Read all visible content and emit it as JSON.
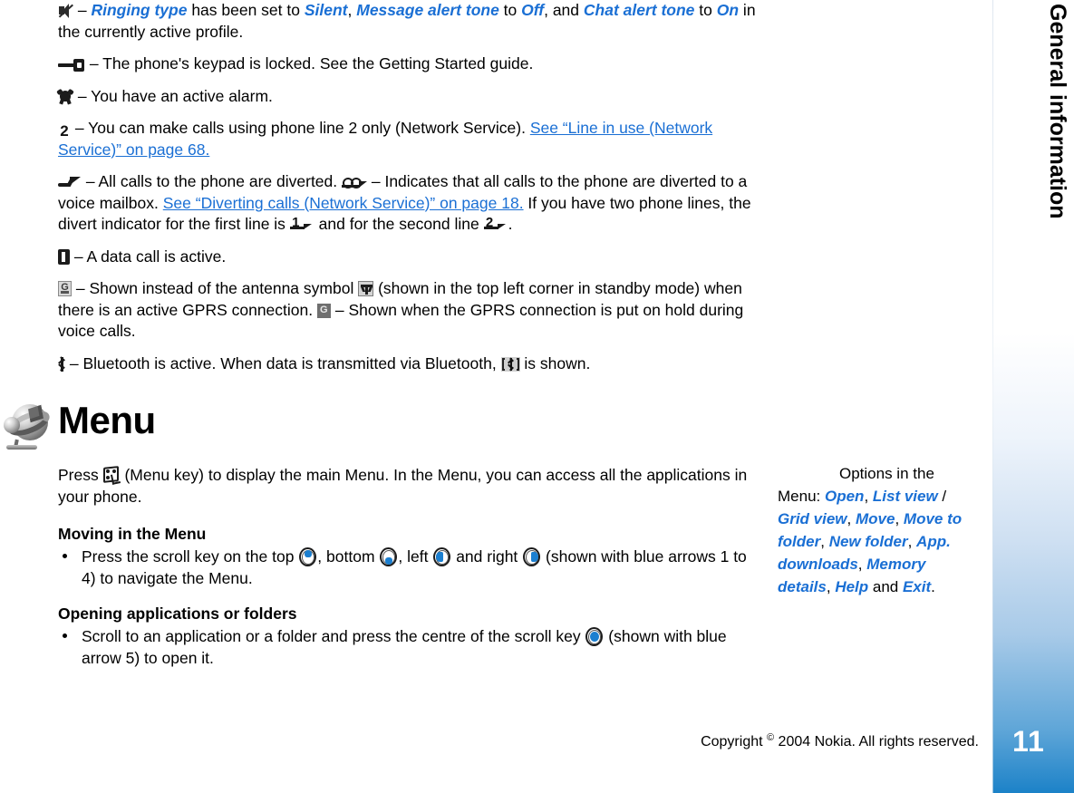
{
  "chapter": {
    "label": "General information"
  },
  "page": {
    "number": "11"
  },
  "colors": {
    "link": "#1a6fd4",
    "accent_blue": "#1b7fd0",
    "page_tab": "#1c82c8"
  },
  "status_icons": [
    {
      "icon": "silent-profile-icon",
      "text_parts": [
        {
          "t": " – ",
          "style": "plain"
        },
        {
          "t": "Ringing type",
          "style": "blue-italic"
        },
        {
          "t": " has been set to ",
          "style": "plain"
        },
        {
          "t": "Silent",
          "style": "blue-italic"
        },
        {
          "t": ", ",
          "style": "plain"
        },
        {
          "t": "Message alert tone",
          "style": "blue-italic"
        },
        {
          "t": " to ",
          "style": "plain"
        },
        {
          "t": "Off",
          "style": "blue-italic"
        },
        {
          "t": ", and ",
          "style": "plain"
        },
        {
          "t": "Chat alert tone",
          "style": "blue-italic"
        },
        {
          "t": " to ",
          "style": "plain"
        },
        {
          "t": "On",
          "style": "blue-italic"
        },
        {
          "t": " in the currently active profile.",
          "style": "plain"
        }
      ]
    },
    {
      "icon": "keypad-lock-icon",
      "text": " – The phone's keypad is locked. See the Getting Started guide."
    },
    {
      "icon": "alarm-icon",
      "text": " – You have an active alarm."
    },
    {
      "icon": "phone-line-2-icon",
      "text_before": " – You can make calls using phone line 2 only (Network Service). ",
      "link": "See “Line in use (Network Service)” on page 68."
    }
  ],
  "divert_paragraph": {
    "icon_divert": "call-divert-icon",
    "text1": " – All calls to the phone are diverted. ",
    "icon_mailbox": "divert-to-voice-mailbox-icon",
    "text2": " – Indicates that all calls to the phone are diverted to a voice mailbox. ",
    "link": "See “Diverting calls (Network Service)” on page 18.",
    "text3": " If you have two phone lines, the divert indicator for the first line is ",
    "icon_line1": "divert-line-1-icon",
    "line1_digit": "1",
    "text4": " and for the second line ",
    "icon_line2": "divert-line-2-icon",
    "line2_digit": "2",
    "text5": "."
  },
  "data_call": {
    "icon": "data-call-icon",
    "text": " – A data call is active."
  },
  "gprs_paragraph": {
    "icon_gprs": "gprs-active-icon",
    "gprs_letter": "G",
    "text1": " – Shown instead of the antenna symbol ",
    "icon_antenna": "antenna-icon",
    "text2": " (shown in the top left corner in standby mode) when there is an active GPRS connection. ",
    "icon_gprs_hold": "gprs-on-hold-icon",
    "text3": " – Shown when the GPRS connection is put on hold during voice calls."
  },
  "bluetooth_paragraph": {
    "icon_bt": "bluetooth-active-icon",
    "text1": " – Bluetooth is active. When data is transmitted via Bluetooth, ",
    "icon_btx": "bluetooth-transmitting-icon",
    "text2": " is shown."
  },
  "menu_section": {
    "icon": "globe-menu-icon",
    "title": "Menu",
    "intro_before": "Press ",
    "menu_key_icon": "menu-key-icon",
    "intro_after": " (Menu key) to display the main Menu. In the Menu, you can access all the applications in your phone.",
    "moving_heading": "Moving in the Menu",
    "moving_bullet": {
      "p1": "Press the scroll key on the top ",
      "p2": ", bottom ",
      "p3": ", left ",
      "p4": " and right ",
      "p5": " (shown with blue arrows 1 to 4) to navigate the Menu.",
      "icons": [
        "scroll-key-up-icon",
        "scroll-key-down-icon",
        "scroll-key-left-icon",
        "scroll-key-right-icon"
      ]
    },
    "opening_heading": "Opening applications or folders",
    "opening_bullet": {
      "p1": "Scroll to an application or a folder and press the centre of the scroll key ",
      "icon": "scroll-key-centre-icon",
      "p2": " (shown with blue arrow 5) to open it."
    }
  },
  "callout": {
    "arrow_icon": "callout-arrow-icon",
    "intro": "Options in the Menu: ",
    "items": [
      {
        "label": "Open",
        "style": "blue"
      },
      {
        "sep": ", "
      },
      {
        "label": "List view",
        "style": "blue"
      },
      {
        "sep": " / "
      },
      {
        "label": "Grid view",
        "style": "blue"
      },
      {
        "sep": ", "
      },
      {
        "label": "Move",
        "style": "blue"
      },
      {
        "sep": ", "
      },
      {
        "label": "Move to folder",
        "style": "blue"
      },
      {
        "sep": ", "
      },
      {
        "label": "New folder",
        "style": "blue"
      },
      {
        "sep": ", "
      },
      {
        "label": "App. downloads",
        "style": "blue"
      },
      {
        "sep": ", "
      },
      {
        "label": "Memory details",
        "style": "blue"
      },
      {
        "sep": ", "
      },
      {
        "label": "Help",
        "style": "blue"
      },
      {
        "sep": " and "
      },
      {
        "label": "Exit",
        "style": "blue"
      },
      {
        "sep": "."
      }
    ]
  },
  "footer": {
    "copyright_pre": "Copyright ",
    "copyright_symbol": "©",
    "copyright_post": " 2004 Nokia. All rights reserved."
  }
}
